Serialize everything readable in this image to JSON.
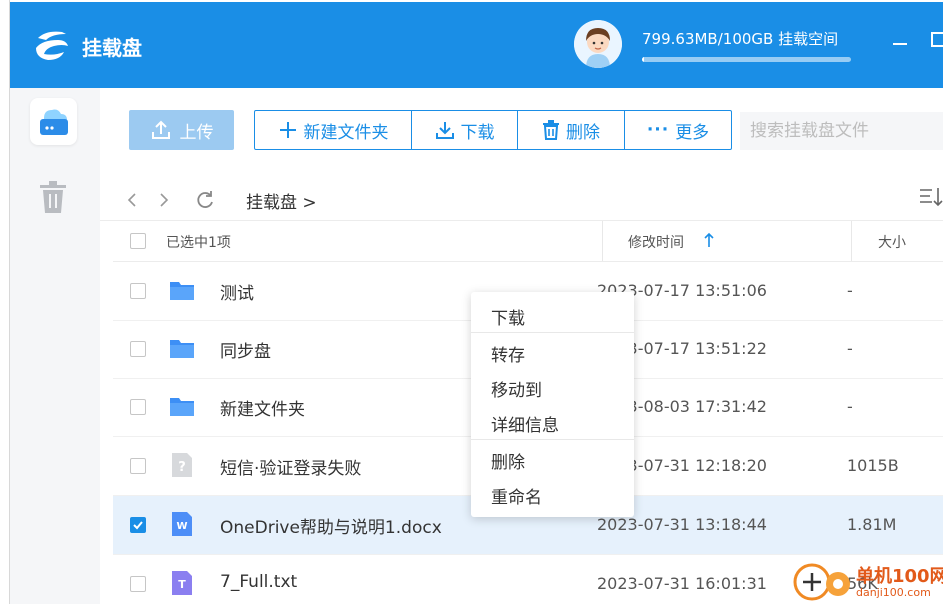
{
  "app": {
    "title": "挂载盘"
  },
  "storage": {
    "text": "799.63MB/100GB  挂载空间",
    "used_fraction": 0.008
  },
  "toolbar": {
    "upload": "上传",
    "new_folder": "新建文件夹",
    "download": "下载",
    "delete": "删除",
    "more": "更多",
    "search_placeholder": "搜索挂载盘文件"
  },
  "breadcrumb": {
    "current": "挂载盘",
    "separator": ">"
  },
  "table": {
    "selected_label": "已选中1项",
    "col_modified": "修改时间",
    "col_size": "大小",
    "rows": [
      {
        "name": "测试",
        "time": "2023-07-17 13:51:06",
        "size": "-",
        "type": "folder",
        "checked": false
      },
      {
        "name": "同步盘",
        "time": "2023-07-17 13:51:22",
        "size": "-",
        "type": "folder",
        "checked": false
      },
      {
        "name": "新建文件夹",
        "time": "2023-08-03 17:31:42",
        "size": "-",
        "type": "folder",
        "checked": false
      },
      {
        "name": "短信·验证登录失败",
        "time": "2023-07-31 12:18:20",
        "size": "1015B",
        "type": "unknown",
        "checked": false
      },
      {
        "name": "OneDrive帮助与说明1.docx",
        "time": "2023-07-31 13:18:44",
        "size": "1.81M",
        "type": "word",
        "checked": true
      },
      {
        "name": "7_Full.txt",
        "time": "2023-07-31 16:01:31",
        "size": "56K",
        "type": "text",
        "checked": false
      }
    ]
  },
  "context_menu": {
    "items": [
      "下载",
      "转存",
      "移动到",
      "详细信息",
      "删除",
      "重命名"
    ]
  },
  "watermark": {
    "line1": "单机100网",
    "line2": "danji100.com"
  },
  "colors": {
    "accent": "#1a8ee6",
    "selected_row": "#e6f1fc",
    "folder": "#3d8ff5"
  }
}
